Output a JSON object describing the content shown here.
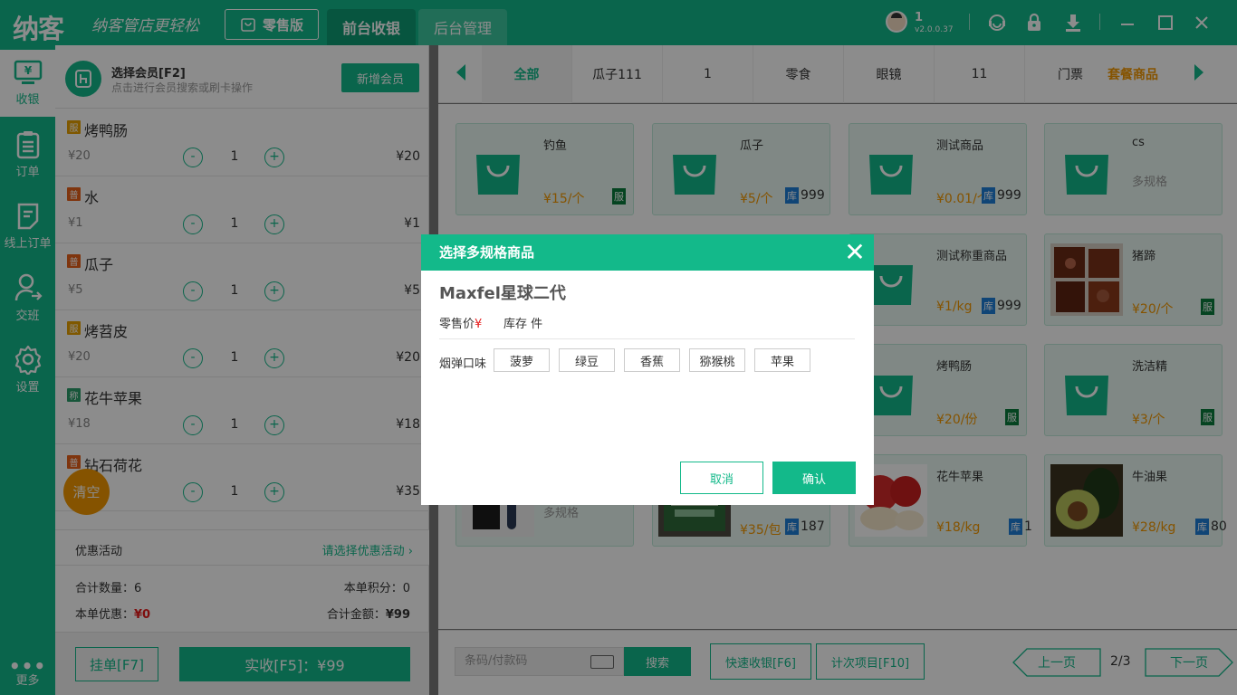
{
  "app": {
    "logo": "纳客",
    "slogan": "纳客管店更轻松",
    "edition": "零售版",
    "tabs": [
      "前台收银",
      "后台管理"
    ],
    "user": "1",
    "version": "v2.0.0.37"
  },
  "sidebar": [
    {
      "label": "收银"
    },
    {
      "label": "订单"
    },
    {
      "label": "线上订单"
    },
    {
      "label": "交班"
    },
    {
      "label": "设置"
    }
  ],
  "more_label": "更多",
  "member": {
    "title": "选择会员[F2]",
    "subtitle": "点击进行会员搜索或刷卡操作",
    "add_label": "新增会员"
  },
  "cart": [
    {
      "badge": "服",
      "badge_color": "#e8a100",
      "name": "烤鸭肠",
      "price": "¥20",
      "qty": "1",
      "total": "¥20"
    },
    {
      "badge": "普",
      "badge_color": "#e8621b",
      "name": "水",
      "price": "¥1",
      "qty": "1",
      "total": "¥1"
    },
    {
      "badge": "普",
      "badge_color": "#e8621b",
      "name": "瓜子",
      "price": "¥5",
      "qty": "1",
      "total": "¥5"
    },
    {
      "badge": "服",
      "badge_color": "#e8a100",
      "name": "烤苕皮",
      "price": "¥20",
      "qty": "1",
      "total": "¥20"
    },
    {
      "badge": "称",
      "badge_color": "#2a9d6a",
      "name": "花牛苹果",
      "price": "¥18",
      "qty": "1",
      "total": "¥18"
    },
    {
      "badge": "普",
      "badge_color": "#e8621b",
      "name": "钻石荷花",
      "price": "¥35",
      "qty": "1",
      "total": "¥35"
    }
  ],
  "clear_label": "清空",
  "promo": {
    "label": "优惠活动",
    "select": "请选择优惠活动"
  },
  "summary": {
    "qty_label": "合计数量：",
    "qty": "6",
    "points_label": "本单积分：",
    "points": "0",
    "discount_label": "本单优惠：",
    "discount": "¥0",
    "total_label": "合计金额：",
    "total": "¥99"
  },
  "actions": {
    "hold": "挂单[F7]",
    "pay": "实收[F5]：¥99"
  },
  "categories": [
    "全部",
    "瓜子111",
    "1",
    "零食",
    "眼镜",
    "11",
    "门票",
    "套餐商品"
  ],
  "products": [
    {
      "name": "钓鱼",
      "price": "¥15/个",
      "tag": "服"
    },
    {
      "name": "瓜子",
      "price": "¥5/个",
      "stock_tag": "库",
      "stock": "999"
    },
    {
      "name": "测试商品",
      "price": "¥0.01/个",
      "stock_tag": "库",
      "stock": "999"
    },
    {
      "name": "cs",
      "multi": "多规格"
    },
    {
      "name": "测试称重商品",
      "price": "¥1/kg",
      "stock_tag": "库",
      "stock": "999"
    },
    {
      "name": "猪蹄",
      "price": "¥20/个",
      "tag": "服"
    },
    {
      "name": "烤鸭肠",
      "price": "¥20/份",
      "tag": "服"
    },
    {
      "name": "洗洁精",
      "price": "¥3/个",
      "tag": "服"
    },
    {
      "name": "",
      "multi": "多规格"
    },
    {
      "name": "",
      "price": "¥35/包",
      "stock_tag": "库",
      "stock": "187"
    },
    {
      "name": "花牛苹果",
      "price": "¥18/kg",
      "stock_tag": "库",
      "stock": "1"
    },
    {
      "name": "牛油果",
      "price": "¥28/kg",
      "stock_tag": "库",
      "stock": "80"
    }
  ],
  "footer": {
    "scan_placeholder": "条码/付款码",
    "search": "搜索",
    "quick": "快速收银[F6]",
    "count": "计次项目[F10]",
    "prev": "上一页",
    "page": "2/3",
    "next": "下一页"
  },
  "dialog": {
    "title": "选择多规格商品",
    "product": "Maxfel星球二代",
    "price_label": "零售价",
    "currency": "¥",
    "stock_label": "库存 件",
    "spec_label": "烟弹口味",
    "options": [
      "菠萝",
      "绿豆",
      "香蕉",
      "猕猴桃",
      "苹果"
    ],
    "cancel": "取消",
    "ok": "确认"
  },
  "colors": {
    "brand": "#13b98a",
    "accent": "#f39800",
    "stock_tag": "#1e7fd8",
    "service_tag": "#0a7d3c"
  }
}
